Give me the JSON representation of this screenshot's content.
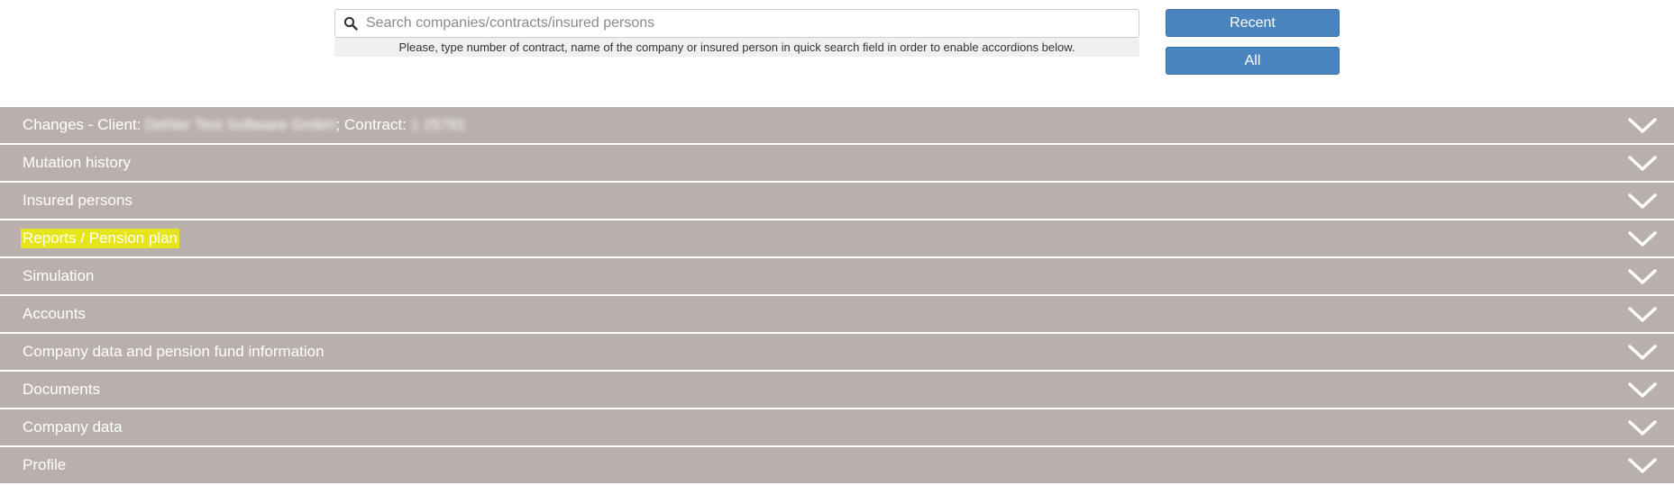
{
  "search": {
    "placeholder": "Search companies/contracts/insured persons",
    "hint": "Please, type number of contract, name of the company or insured person in quick search field in order to enable accordions below."
  },
  "buttons": {
    "recent": "Recent",
    "all": "All"
  },
  "accordion": {
    "changes": {
      "prefix": "Changes - Client: ",
      "client": "Dehler Test Software GmbH",
      "contract_prefix": "; Contract: ",
      "contract": "1 25781"
    },
    "items": [
      {
        "label": "Mutation history"
      },
      {
        "label": "Insured persons"
      },
      {
        "label": "Reports / Pension plan"
      },
      {
        "label": "Simulation"
      },
      {
        "label": "Accounts"
      },
      {
        "label": "Company data and pension fund information"
      },
      {
        "label": "Documents"
      },
      {
        "label": "Company data"
      },
      {
        "label": "Profile"
      }
    ]
  },
  "colors": {
    "accordion_bg": "#b9b0ad",
    "button_bg": "#4a84bf",
    "highlight": "#e6e51b"
  },
  "icons": {
    "search": "search-icon",
    "expand": "chevron-down-icon"
  }
}
